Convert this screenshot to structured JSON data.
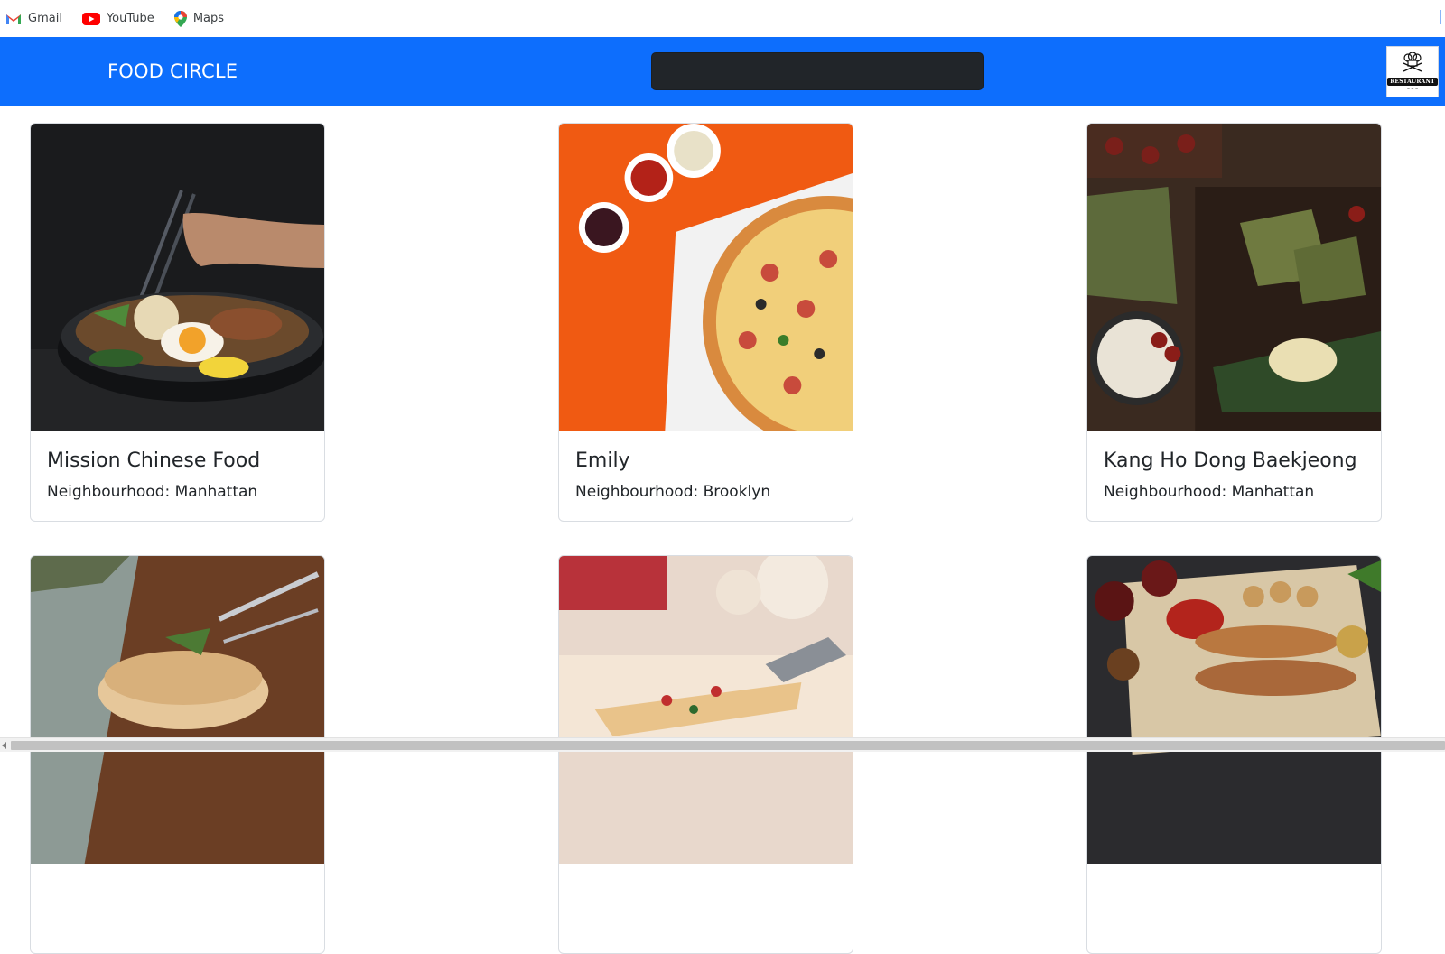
{
  "bookmarks": [
    {
      "label": "Gmail",
      "icon": "gmail-icon"
    },
    {
      "label": "YouTube",
      "icon": "youtube-icon"
    },
    {
      "label": "Maps",
      "icon": "maps-icon"
    }
  ],
  "navbar": {
    "brand": "FOOD CIRCLE",
    "search_value": "",
    "logo_text": "RESTAURANT",
    "accent_color": "#0d6efd"
  },
  "cards": [
    {
      "name": "Mission Chinese Food",
      "neighbourhood": "Neighbourhood: Manhattan",
      "image": "ramen-bowl-photo"
    },
    {
      "name": "Emily",
      "neighbourhood": "Neighbourhood: Brooklyn",
      "image": "pizza-photo"
    },
    {
      "name": "Kang Ho Dong Baekjeong",
      "neighbourhood": "Neighbourhood: Manhattan",
      "image": "asian-dumplings-photo"
    },
    {
      "image": "sandwich-photo"
    },
    {
      "image": "pizza-slice-photo"
    },
    {
      "image": "grilled-meat-photo"
    }
  ]
}
